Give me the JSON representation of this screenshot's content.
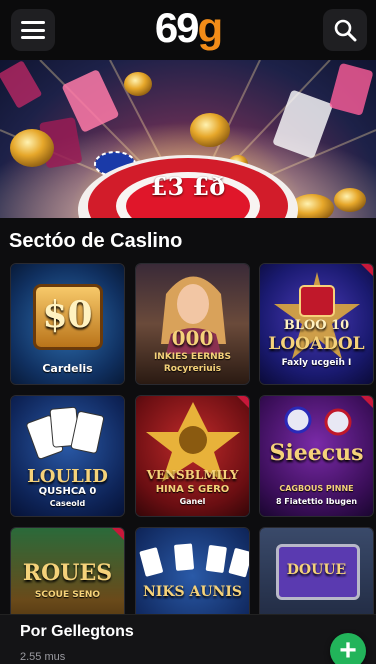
{
  "header": {
    "logo_part1": "69",
    "logo_part2": "g"
  },
  "hero": {
    "chip_text": "£3 £ð"
  },
  "section": {
    "title": "Sectóo de Caslino"
  },
  "games": [
    {
      "title": "$0",
      "subtitle": "Cardelis"
    },
    {
      "title": "000",
      "subtitle": "INKIES EERNBS",
      "subtitle2": "Rocyreriuis"
    },
    {
      "title": "BLOO 10",
      "title2": "LOOADOL",
      "subtitle": "Faxly ucgeih I"
    },
    {
      "title": "LOULID",
      "subtitle": "QUSHCA 0",
      "subtitle2": "Caseold"
    },
    {
      "title": "VENSBLMILY",
      "subtitle": "HINA S GERO",
      "subtitle2": "Ganel"
    },
    {
      "title": "Sieecus",
      "subtitle": "CAGBOUS PINNE",
      "subtitle2": "8 Fiatettio Ibugen"
    },
    {
      "title": "ROUES",
      "subtitle": "SCOUE SENO"
    },
    {
      "title": "NIKS AUNIS",
      "subtitle": ""
    },
    {
      "title": "DOUUE",
      "subtitle": ""
    }
  ],
  "bottom": {
    "title": "Por Gellegtons",
    "subtitle": "2.55 mus"
  },
  "colors": {
    "brand_orange": "#f28c18",
    "fab_green": "#22b45a",
    "badge_red": "#c7183a"
  }
}
